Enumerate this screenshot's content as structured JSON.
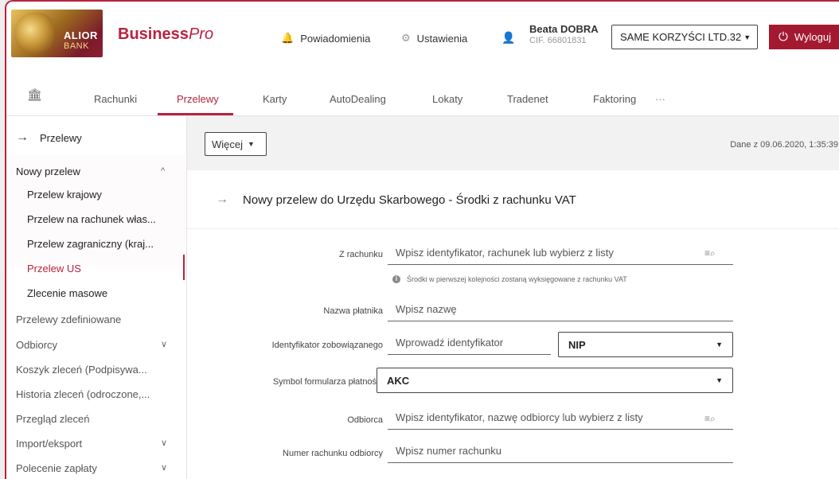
{
  "header": {
    "logo_line1": "ALIOR",
    "logo_line2": "BANK",
    "brand_bold": "Business",
    "brand_italic": "Pro",
    "notifications": "Powiadomienia",
    "settings": "Ustawienia",
    "user_name": "Beata DOBRA",
    "user_cif": "CIF. 66801831",
    "company": "SAME KORZYŚCI LTD.32",
    "logout": "Wyloguj"
  },
  "nav": {
    "tabs": [
      "Rachunki",
      "Przelewy",
      "Karty",
      "AutoDealing",
      "Lokaty",
      "Tradenet",
      "Faktoring"
    ],
    "active_tab": "Przelewy",
    "more": "···"
  },
  "sidebar": {
    "top": "Przelewy",
    "group": "Nowy przelew",
    "group_items": [
      "Przelew krajowy",
      "Przelew na rachunek włas...",
      "Przelew zagraniczny (kraj...",
      "Przelew US",
      "Zlecenie masowe"
    ],
    "active_item": "Przelew US",
    "items": [
      "Przelewy zdefiniowane",
      "Odbiorcy",
      "Koszyk zleceń (Podpisywa...",
      "Historia zleceń (odroczone,...",
      "Przegląd zleceń",
      "Import/eksport",
      "Polecenie zapłaty"
    ]
  },
  "main": {
    "more_button": "Więcej",
    "data_time": "Dane z 09.06.2020, 1:35:39",
    "page_title": "Nowy przelew do Urzędu Skarbowego - Środki z rachunku VAT"
  },
  "form": {
    "from_account": {
      "label": "Z rachunku",
      "placeholder": "Wpisz identyfikator, rachunek lub wybierz z listy"
    },
    "hint": "Środki w pierwszej kolejności zostaną wyksięgowane z rachunku VAT",
    "payer_name": {
      "label": "Nazwa płatnika",
      "placeholder": "Wpisz nazwę"
    },
    "obligor_id": {
      "label": "Identyfikator zobowiązanego",
      "placeholder": "Wprowadź identyfikator",
      "type_value": "NIP"
    },
    "form_symbol": {
      "label": "Symbol formularza płatności",
      "value": "AKC"
    },
    "recipient": {
      "label": "Odbiorca",
      "placeholder": "Wpisz identyfikator, nazwę odbiorcy lub wybierz z listy"
    },
    "recipient_account": {
      "label": "Numer rachunku odbiorcy",
      "placeholder": "Wpisz numer rachunku"
    }
  }
}
